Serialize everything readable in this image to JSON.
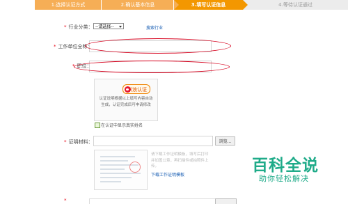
{
  "steps": [
    {
      "label": "1.选择认证方式",
      "state": "done"
    },
    {
      "label": "2.确认基本信息",
      "state": "done"
    },
    {
      "label": "3.填写认证信息",
      "state": "active"
    },
    {
      "label": "4.等待认证通过",
      "state": "pending"
    }
  ],
  "form": {
    "industry": {
      "label": "行业分类：",
      "selected": "--请选择--",
      "link": "搜索行业"
    },
    "employer": {
      "label": "工作单位全称："
    },
    "position": {
      "label": "职位："
    },
    "weibo": {
      "button_label": "新浪认证",
      "description": "认证说明根据以上填写内容自动生成，认证完成后可申请修改"
    },
    "show_real_name": {
      "label": "在认证中显示真实姓名"
    },
    "proof": {
      "label": "证明材料：",
      "browse_label": "浏览...",
      "sample_text": "请下载工作证明模板，填写后打印并加盖公章，再扫描件或拍照件上传。",
      "download_link": "下载工作证明模板"
    }
  },
  "watermark": {
    "title": "百科全说",
    "subtitle": "助你轻松解决"
  },
  "colors": {
    "active_step": "#f39700",
    "done_step": "#f6ae56",
    "required": "#e60012",
    "annotation": "#d6001c",
    "watermark": "#1fab89"
  }
}
